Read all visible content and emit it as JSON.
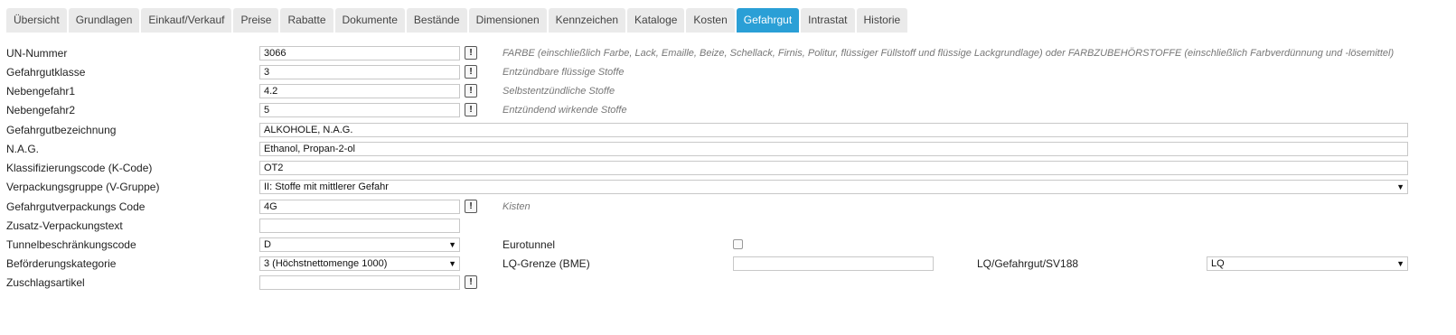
{
  "tabs": [
    {
      "label": "Übersicht",
      "active": false
    },
    {
      "label": "Grundlagen",
      "active": false
    },
    {
      "label": "Einkauf/Verkauf",
      "active": false
    },
    {
      "label": "Preise",
      "active": false
    },
    {
      "label": "Rabatte",
      "active": false
    },
    {
      "label": "Dokumente",
      "active": false
    },
    {
      "label": "Bestände",
      "active": false
    },
    {
      "label": "Dimensionen",
      "active": false
    },
    {
      "label": "Kennzeichen",
      "active": false
    },
    {
      "label": "Kataloge",
      "active": false
    },
    {
      "label": "Kosten",
      "active": false
    },
    {
      "label": "Gefahrgut",
      "active": true
    },
    {
      "label": "Intrastat",
      "active": false
    },
    {
      "label": "Historie",
      "active": false
    }
  ],
  "form": {
    "un_nummer": {
      "label": "UN-Nummer",
      "value": "3066",
      "desc": "FARBE (einschließlich Farbe, Lack, Emaille, Beize, Schellack, Firnis, Politur, flüssiger Füllstoff und flüssige Lackgrundlage) oder FARBZUBEHÖRSTOFFE (einschließlich Farbverdünnung und -lösemittel)"
    },
    "gefahrgutklasse": {
      "label": "Gefahrgutklasse",
      "value": "3",
      "desc": "Entzündbare flüssige Stoffe"
    },
    "nebengefahr1": {
      "label": "Nebengefahr1",
      "value": "4.2",
      "desc": "Selbstentzündliche Stoffe"
    },
    "nebengefahr2": {
      "label": "Nebengefahr2",
      "value": "5",
      "desc": "Entzündend wirkende Stoffe"
    },
    "bezeichnung": {
      "label": "Gefahrgutbezeichnung",
      "value": "ALKOHOLE, N.A.G."
    },
    "nag": {
      "label": "N.A.G.",
      "value": "Ethanol, Propan-2-ol"
    },
    "kcode": {
      "label": "Klassifizierungscode (K-Code)",
      "value": "OT2"
    },
    "vgruppe": {
      "label": "Verpackungsgruppe (V-Gruppe)",
      "value": "II: Stoffe mit mittlerer Gefahr"
    },
    "verpackungscode": {
      "label": "Gefahrgutverpackungs Code",
      "value": "4G",
      "desc": "Kisten"
    },
    "zusatztext": {
      "label": "Zusatz-Verpackungstext",
      "value": ""
    },
    "tunnel": {
      "label": "Tunnelbeschränkungscode",
      "value": "D"
    },
    "eurotunnel": {
      "label": "Eurotunnel",
      "checked": false
    },
    "befoerderung": {
      "label": "Beförderungskategorie",
      "value": "3 (Höchstnettomenge 1000)"
    },
    "lq_grenze": {
      "label": "LQ-Grenze (BME)",
      "value": ""
    },
    "lq_sv188": {
      "label": "LQ/Gefahrgut/SV188",
      "value": "LQ"
    },
    "zuschlag": {
      "label": "Zuschlagsartikel",
      "value": ""
    }
  },
  "icons": {
    "info_button_glyph": "!",
    "dropdown_glyph": "▼"
  }
}
